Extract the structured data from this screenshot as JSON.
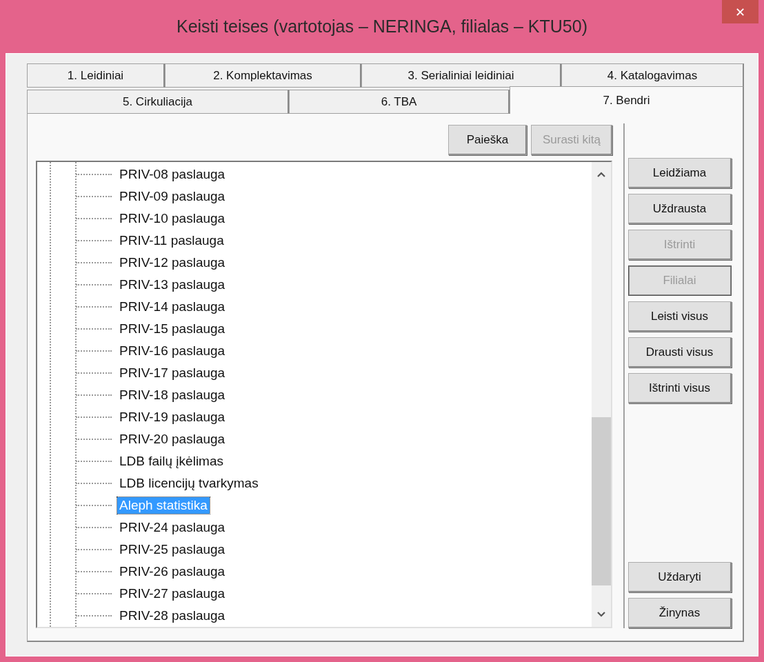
{
  "window": {
    "title": "Keisti teises (vartotojas – NERINGA, filialas – KTU50)",
    "close": "✕"
  },
  "tab_rows": [
    [
      {
        "label": "1. Leidiniai",
        "selected": false
      },
      {
        "label": "2. Komplektavimas",
        "selected": false
      },
      {
        "label": "3. Serialiniai leidiniai",
        "selected": false
      },
      {
        "label": "4. Katalogavimas",
        "selected": false
      }
    ],
    [
      {
        "label": "5. Cirkuliacija",
        "selected": false
      },
      {
        "label": "6. TBA",
        "selected": false
      },
      {
        "label": "7. Bendri",
        "selected": true
      }
    ]
  ],
  "search_buttons": [
    {
      "label": "Paieška",
      "disabled": false
    },
    {
      "label": "Surasti kitą",
      "disabled": true
    }
  ],
  "tree": {
    "items": [
      {
        "label": "PRIV-08 paslauga",
        "selected": false
      },
      {
        "label": "PRIV-09 paslauga",
        "selected": false
      },
      {
        "label": "PRIV-10 paslauga",
        "selected": false
      },
      {
        "label": "PRIV-11 paslauga",
        "selected": false
      },
      {
        "label": "PRIV-12 paslauga",
        "selected": false
      },
      {
        "label": "PRIV-13 paslauga",
        "selected": false
      },
      {
        "label": "PRIV-14 paslauga",
        "selected": false
      },
      {
        "label": "PRIV-15 paslauga",
        "selected": false
      },
      {
        "label": "PRIV-16 paslauga",
        "selected": false
      },
      {
        "label": "PRIV-17 paslauga",
        "selected": false
      },
      {
        "label": "PRIV-18 paslauga",
        "selected": false
      },
      {
        "label": "PRIV-19 paslauga",
        "selected": false
      },
      {
        "label": "PRIV-20 paslauga",
        "selected": false
      },
      {
        "label": "LDB failų įkėlimas",
        "selected": false
      },
      {
        "label": "LDB licencijų tvarkymas",
        "selected": false
      },
      {
        "label": "Aleph statistika",
        "selected": true
      },
      {
        "label": "PRIV-24 paslauga",
        "selected": false
      },
      {
        "label": "PRIV-25 paslauga",
        "selected": false
      },
      {
        "label": "PRIV-26 paslauga",
        "selected": false
      },
      {
        "label": "PRIV-27 paslauga",
        "selected": false
      },
      {
        "label": "PRIV-28 paslauga",
        "selected": false
      }
    ]
  },
  "action_buttons": [
    {
      "label": "Leidžiama",
      "disabled": false,
      "default": false
    },
    {
      "label": "Uždrausta",
      "disabled": false,
      "default": false
    },
    {
      "label": "Ištrinti",
      "disabled": true,
      "default": false
    },
    {
      "label": "Filialai",
      "disabled": true,
      "default": true
    },
    {
      "label": "Leisti visus",
      "disabled": false,
      "default": false
    },
    {
      "label": "Drausti visus",
      "disabled": false,
      "default": false
    },
    {
      "label": "Ištrinti visus",
      "disabled": false,
      "default": false
    }
  ],
  "bottom_buttons": [
    {
      "label": "Uždaryti",
      "disabled": false,
      "default": false
    },
    {
      "label": "Žinynas",
      "disabled": false,
      "default": false
    }
  ]
}
